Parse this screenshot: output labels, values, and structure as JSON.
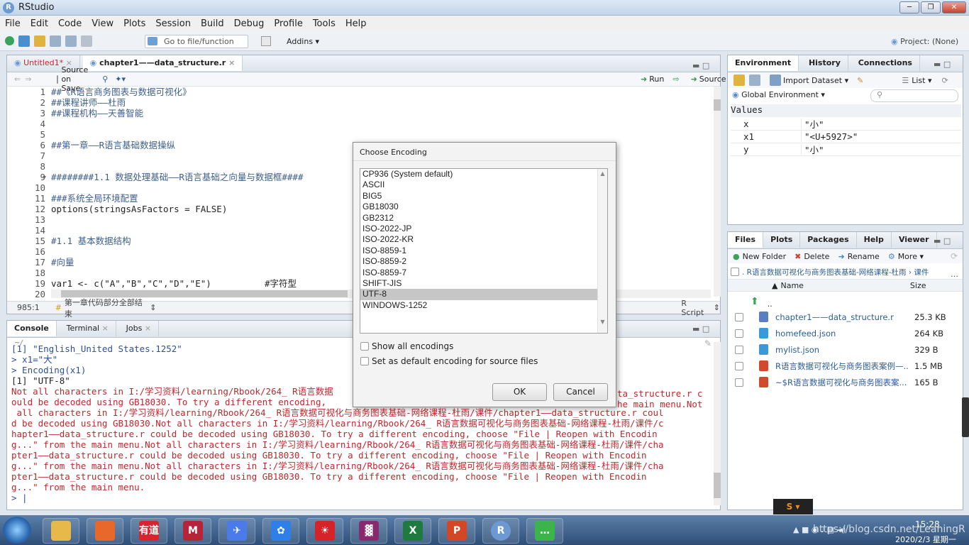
{
  "window": {
    "title": "RStudio",
    "logo": "R"
  },
  "menu": [
    "File",
    "Edit",
    "Code",
    "View",
    "Plots",
    "Session",
    "Build",
    "Debug",
    "Profile",
    "Tools",
    "Help"
  ],
  "toolbar": {
    "goto_placeholder": "Go to file/function",
    "addins": "Addins",
    "project": "Project: (None)"
  },
  "editor": {
    "tabs": [
      "Untitled1*",
      "chapter1——data_structure.r"
    ],
    "source_on_save": "Source on Save",
    "run": "Run",
    "source": "Source",
    "lines": [
      {
        "n": "1",
        "t": "##《R语言商务图表与数据可视化》"
      },
      {
        "n": "2",
        "t": "##课程讲师——杜雨"
      },
      {
        "n": "3",
        "t": "##课程机构——天善智能"
      },
      {
        "n": "4",
        "t": ""
      },
      {
        "n": "5",
        "t": ""
      },
      {
        "n": "6",
        "t": "##第一章——R语言基础数据操纵"
      },
      {
        "n": "7",
        "t": ""
      },
      {
        "n": "8",
        "t": ""
      },
      {
        "n": "9",
        "t": "########1.1 数据处理基础——R语言基础之向量与数据框####"
      },
      {
        "n": "10",
        "t": ""
      },
      {
        "n": "11",
        "t": "###系统全局环境配置"
      },
      {
        "n": "12",
        "t": "options(stringsAsFactors = FALSE)"
      },
      {
        "n": "13",
        "t": ""
      },
      {
        "n": "14",
        "t": ""
      },
      {
        "n": "15",
        "t": "#1.1 基本数据结构"
      },
      {
        "n": "16",
        "t": ""
      },
      {
        "n": "17",
        "t": "#向量"
      },
      {
        "n": "18",
        "t": ""
      },
      {
        "n": "19",
        "t": "var1 <- c(\"A\",\"B\",\"C\",\"D\",\"E\")          #字符型"
      },
      {
        "n": "20",
        "t": ""
      }
    ],
    "status_pos": "985:1",
    "status_section": "第一章代码部分全部结束",
    "status_type": "R Script"
  },
  "console": {
    "tabs": [
      "Console",
      "Terminal",
      "Jobs"
    ],
    "wd": "~/",
    "lines": [
      {
        "c": "cmd",
        "t": "[1] \"English_United States.1252\""
      },
      {
        "c": "cmd",
        "t": "> x1=\"大\""
      },
      {
        "c": "cmd",
        "t": "> Encoding(x1)"
      },
      {
        "c": "out",
        "t": "[1] \"UTF-8\""
      },
      {
        "c": "err",
        "t": "Not all characters in I:/学习资料/learning/Rbook/264_ R语言数据"
      },
      {
        "c": "err",
        "t": "ould be decoded using GB18030. To try a different encoding,"
      },
      {
        "c": "err",
        "t": " all characters in I:/学习资料/learning/Rbook/264_ R语言数据可视化与商务图表基础-网络课程-杜雨/课件/chapter1——data_structure.r coul"
      },
      {
        "c": "err",
        "t": "d be decoded using GB18030.Not all characters in I:/学习资料/learning/Rbook/264_ R语言数据可视化与商务图表基础-网络课程-杜雨/课件/c"
      },
      {
        "c": "err",
        "t": "hapter1——data_structure.r could be decoded using GB18030. To try a different encoding, choose \"File | Reopen with Encodin"
      },
      {
        "c": "err",
        "t": "g...\" from the main menu.Not all characters in I:/学习资料/learning/Rbook/264_ R语言数据可视化与商务图表基础-网络课程-杜雨/课件/cha"
      },
      {
        "c": "err",
        "t": "pter1——data_structure.r could be decoded using GB18030. To try a different encoding, choose \"File | Reopen with Encodin"
      },
      {
        "c": "err",
        "t": "g...\" from the main menu.Not all characters in I:/学习资料/learning/Rbook/264_ R语言数据可视化与商务图表基础-网络课程-杜雨/课件/cha"
      },
      {
        "c": "err",
        "t": "pter1——data_structure.r could be decoded using GB18030. To try a different encoding, choose \"File | Reopen with Encodin"
      },
      {
        "c": "err",
        "t": "g...\" from the main menu."
      },
      {
        "c": "cmd",
        "t": "> |"
      }
    ],
    "right_fragments": [
      "ta_structure.r c",
      "he main menu.Not"
    ]
  },
  "env": {
    "tabs": [
      "Environment",
      "History",
      "Connections"
    ],
    "import": "Import Dataset",
    "list": "List",
    "global": "Global Environment",
    "values_header": "Values",
    "rows": [
      {
        "name": "x",
        "val": "\"小\""
      },
      {
        "name": "x1",
        "val": "\"<U+5927>\""
      },
      {
        "name": "y",
        "val": "\"小\""
      }
    ]
  },
  "files": {
    "tabs": [
      "Files",
      "Plots",
      "Packages",
      "Help",
      "Viewer"
    ],
    "new_folder": "New Folder",
    "delete": "Delete",
    "rename": "Rename",
    "more": "More",
    "path": ". R语言数据可视化与商务图表基础-网络课程-杜雨 › 课件",
    "col_name": "Name",
    "col_size": "Size",
    "updir": "..",
    "rows": [
      {
        "name": "chapter1——data_structure.r",
        "size": "25.3 KB",
        "color": "#5a7fc0"
      },
      {
        "name": "homefeed.json",
        "size": "264 KB",
        "color": "#3a9ad9"
      },
      {
        "name": "mylist.json",
        "size": "329 B",
        "color": "#3a9ad9"
      },
      {
        "name": "R语言数据可视化与商务图表案例—...",
        "size": "1.5 MB",
        "color": "#d24a2e"
      },
      {
        "name": "~$R语言数据可视化与商务图表案...",
        "size": "165 B",
        "color": "#d24a2e"
      }
    ]
  },
  "dialog": {
    "title": "Choose Encoding",
    "options": [
      "CP936 (System default)",
      "ASCII",
      "BIG5",
      "GB18030",
      "GB2312",
      "ISO-2022-JP",
      "ISO-2022-KR",
      "ISO-8859-1",
      "ISO-8859-2",
      "ISO-8859-7",
      "SHIFT-JIS",
      "UTF-8",
      "WINDOWS-1252"
    ],
    "selected": "UTF-8",
    "show_all": "Show all encodings",
    "set_default": "Set as default encoding for source files",
    "ok": "OK",
    "cancel": "Cancel"
  },
  "taskbar": {
    "apps": [
      {
        "name": "explorer",
        "label": "",
        "color": "#e7b84a"
      },
      {
        "name": "firefox",
        "label": "",
        "color": "#e8672b"
      },
      {
        "name": "youdao",
        "label": "有道",
        "color": "#d9232e"
      },
      {
        "name": "mindmaster",
        "label": "M",
        "color": "#b6243a"
      },
      {
        "name": "feishu",
        "label": "✈",
        "color": "#4b7be8"
      },
      {
        "name": "baidunetdisk",
        "label": "✿",
        "color": "#2f7fe8"
      },
      {
        "name": "acrobat",
        "label": "☀",
        "color": "#d5232a"
      },
      {
        "name": "winrar",
        "label": "▓",
        "color": "#8a2a6e"
      },
      {
        "name": "excel",
        "label": "X",
        "color": "#1f7a3f"
      },
      {
        "name": "powerpoint",
        "label": "P",
        "color": "#d24726"
      },
      {
        "name": "rstudio",
        "label": "R",
        "color": "#6d99d3"
      },
      {
        "name": "wechat",
        "label": "…",
        "color": "#3bb54a"
      }
    ],
    "time": "15:28",
    "date": "2020/2/3 星期一",
    "watermark": "https://blog.csdn.net/LeaningR"
  }
}
